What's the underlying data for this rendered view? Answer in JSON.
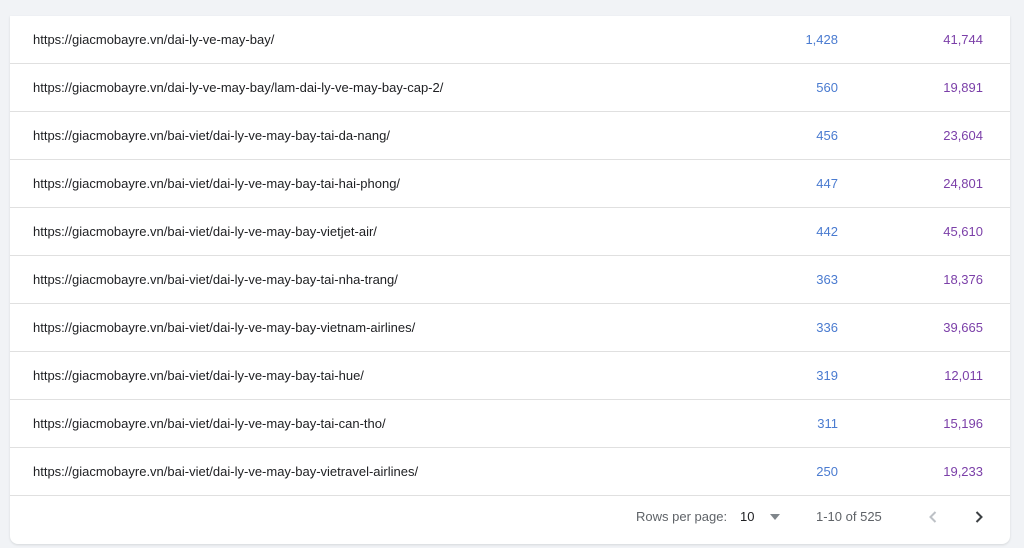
{
  "table": {
    "rows": [
      {
        "url": "https://giacmobayre.vn/dai-ly-ve-may-bay/",
        "clicks": "1,428",
        "impressions": "41,744"
      },
      {
        "url": "https://giacmobayre.vn/dai-ly-ve-may-bay/lam-dai-ly-ve-may-bay-cap-2/",
        "clicks": "560",
        "impressions": "19,891"
      },
      {
        "url": "https://giacmobayre.vn/bai-viet/dai-ly-ve-may-bay-tai-da-nang/",
        "clicks": "456",
        "impressions": "23,604"
      },
      {
        "url": "https://giacmobayre.vn/bai-viet/dai-ly-ve-may-bay-tai-hai-phong/",
        "clicks": "447",
        "impressions": "24,801"
      },
      {
        "url": "https://giacmobayre.vn/bai-viet/dai-ly-ve-may-bay-vietjet-air/",
        "clicks": "442",
        "impressions": "45,610"
      },
      {
        "url": "https://giacmobayre.vn/bai-viet/dai-ly-ve-may-bay-tai-nha-trang/",
        "clicks": "363",
        "impressions": "18,376"
      },
      {
        "url": "https://giacmobayre.vn/bai-viet/dai-ly-ve-may-bay-vietnam-airlines/",
        "clicks": "336",
        "impressions": "39,665"
      },
      {
        "url": "https://giacmobayre.vn/bai-viet/dai-ly-ve-may-bay-tai-hue/",
        "clicks": "319",
        "impressions": "12,011"
      },
      {
        "url": "https://giacmobayre.vn/bai-viet/dai-ly-ve-may-bay-tai-can-tho/",
        "clicks": "311",
        "impressions": "15,196"
      },
      {
        "url": "https://giacmobayre.vn/bai-viet/dai-ly-ve-may-bay-vietravel-airlines/",
        "clicks": "250",
        "impressions": "19,233"
      }
    ]
  },
  "pagination": {
    "rows_per_page_label": "Rows per page:",
    "rows_per_page_value": "10",
    "range_text": "1-10 of 525",
    "prev_icon": "chevron-left-icon",
    "next_icon": "chevron-right-icon"
  },
  "colors": {
    "clicks": "#4a7bd0",
    "impressions": "#7b3fa8",
    "background": "#f1f3f6"
  }
}
